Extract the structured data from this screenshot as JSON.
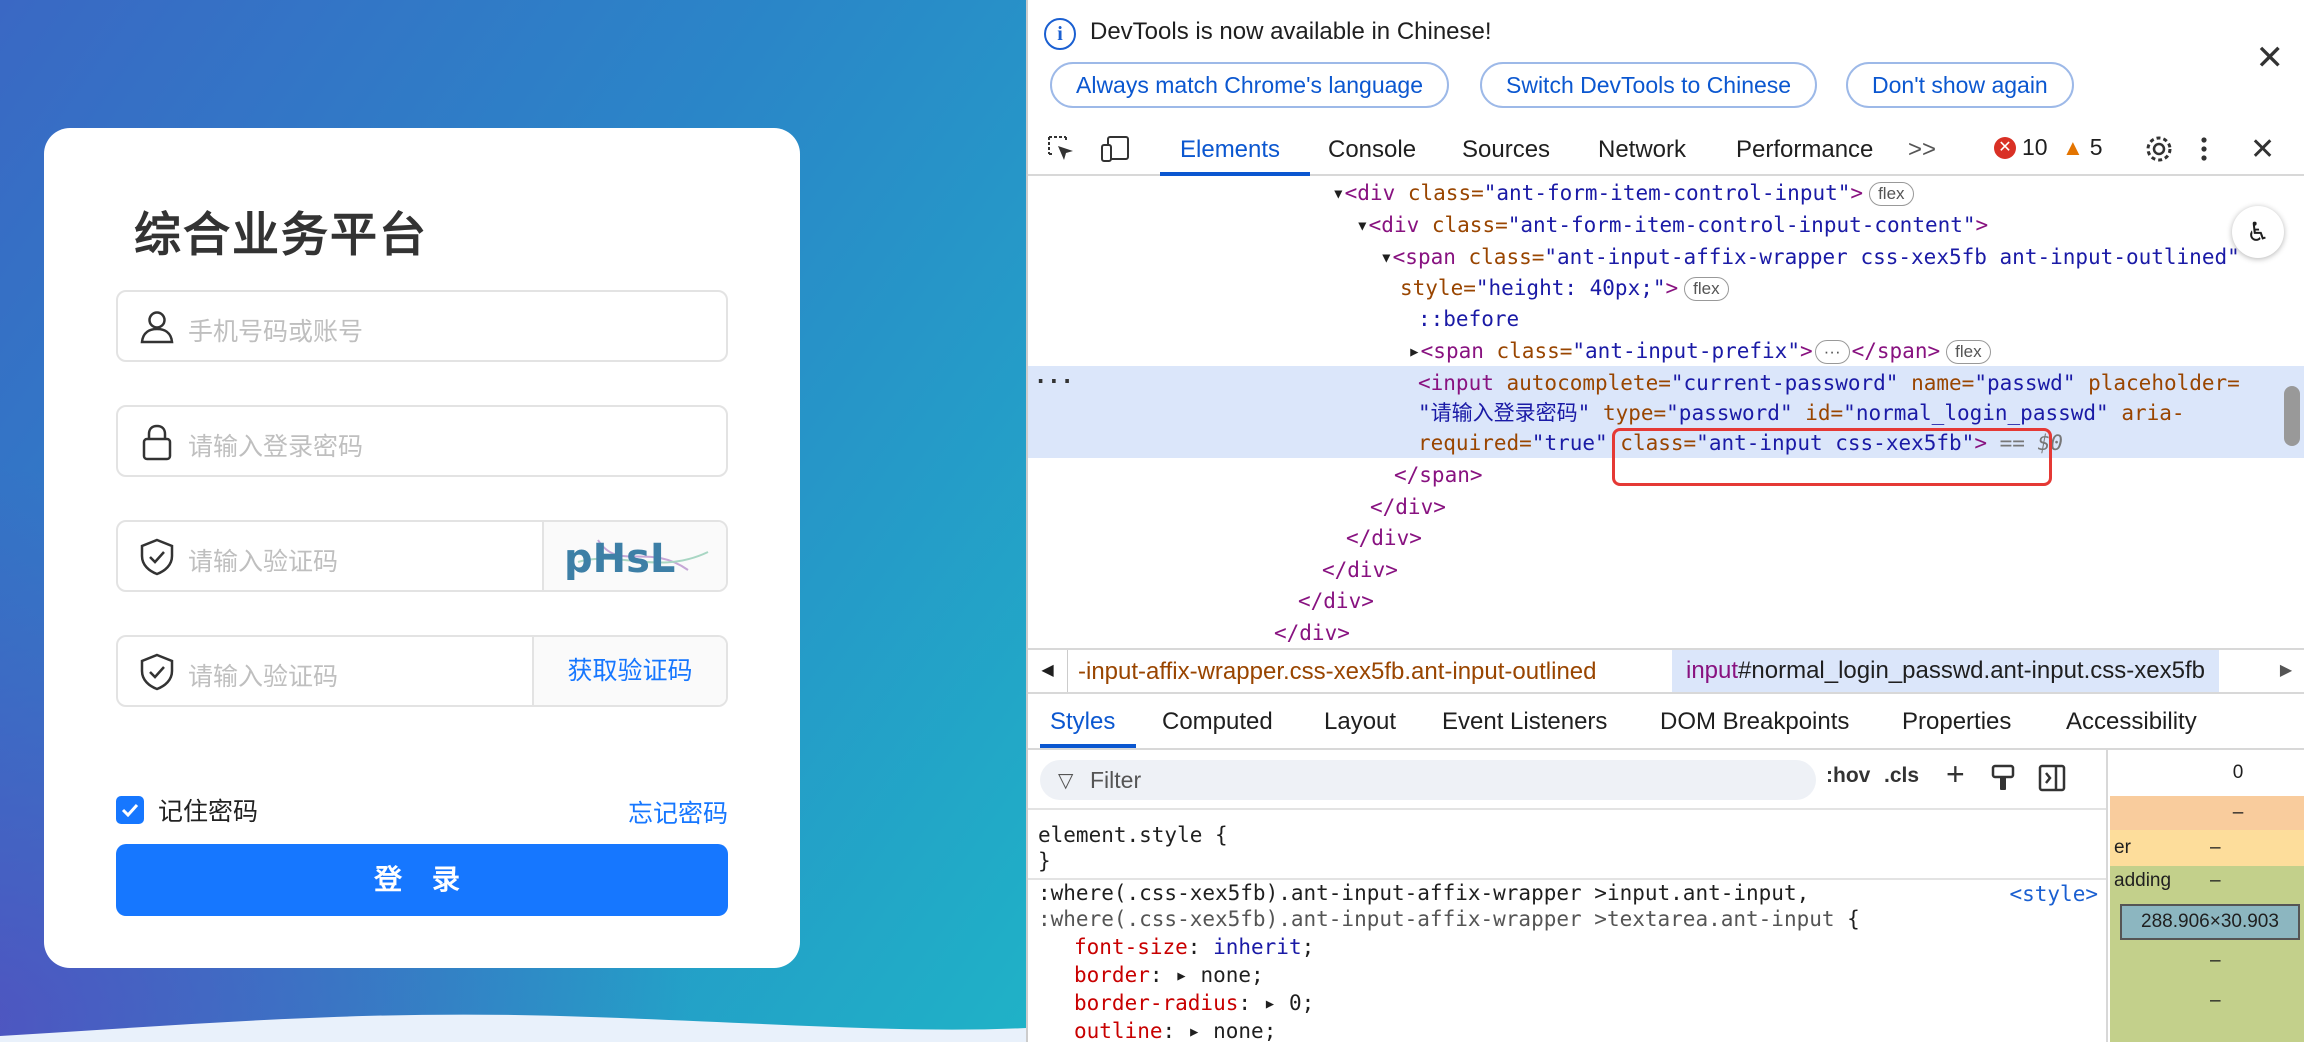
{
  "login": {
    "title": "综合业务平台",
    "phone_placeholder": "手机号码或账号",
    "password_placeholder": "请输入登录密码",
    "captcha_placeholder": "请输入验证码",
    "captcha_text": "pHsL",
    "sms_placeholder": "请输入验证码",
    "sms_button": "获取验证码",
    "remember_label": "记住密码",
    "remember_checked": true,
    "forgot_link": "忘记密码",
    "login_button": "登 录",
    "brand_color": "#1677ff"
  },
  "devtools": {
    "infobar": {
      "message": "DevTools is now available in Chinese!",
      "btn_match": "Always match Chrome's language",
      "btn_switch": "Switch DevTools to Chinese",
      "btn_dont": "Don't show again"
    },
    "tabs": [
      "Elements",
      "Console",
      "Sources",
      "Network",
      "Performance"
    ],
    "active_tab": "Elements",
    "more_tabs": ">>",
    "errors": "10",
    "warnings": "5",
    "dom_lines": {
      "l1_tag": "<div",
      "l1_attr": " class=",
      "l1_val": "\"ant-form-item-control-input\"",
      "l1_end": ">",
      "l2_tag": "<div",
      "l2_attr": " class=",
      "l2_val": "\"ant-form-item-control-input-content\"",
      "l2_end": ">",
      "l3_tag": "<span",
      "l3_attr": " class=",
      "l3_val": "\"ant-input-affix-wrapper css-xex5fb ant-input-outlined\"",
      "l4_attr": "style=",
      "l4_val": "\"height: 40px;\"",
      "l4_end": ">",
      "l5": "::before",
      "l6_tag": "<span",
      "l6_attr": " class=",
      "l6_val": "\"ant-input-prefix\"",
      "l6_end": ">",
      "l6_close": "</span>",
      "l7_tag": "<input",
      "l7_a1": " autocomplete=",
      "l7_v1": "\"current-password\"",
      "l7_a2": " name=",
      "l7_v2": "\"passwd\"",
      "l7_a3": " placeholder=",
      "l8_v3": "\"请输入登录密码\"",
      "l8_a4": " type=",
      "l8_v4": "\"password\"",
      "l8_a5": " id=",
      "l8_v5": "\"normal_login_passwd\"",
      "l8_a6": " aria-",
      "l9_a6": "required=",
      "l9_v6": "\"true\"",
      "l9_a7": " class=",
      "l9_v7": "\"ant-input css-xex5fb\"",
      "l9_end": ">",
      "l9_eq": " == ",
      "l9_ref": "$0",
      "close_span": "</span>",
      "close_div": "</div>",
      "flex_badge": "flex",
      "ellipsis": "..."
    },
    "breadcrumbs": {
      "crumb1": "-input-affix-wrapper.css-xex5fb.ant-input-outlined",
      "crumb2_tag": "input",
      "crumb2_rest": "#normal_login_passwd.ant-input.css-xex5fb"
    },
    "subtabs": [
      "Styles",
      "Computed",
      "Layout",
      "Event Listeners",
      "DOM Breakpoints",
      "Properties",
      "Accessibility"
    ],
    "active_subtab": "Styles",
    "filter_placeholder": "Filter",
    "hov": ":hov",
    "cls": ".cls",
    "styles": {
      "element_style": "element.style {",
      "close_brace": "}",
      "rule_selector_1": ":where(.css-xex5fb).ant-input-affix-wrapper >input.ant-input,",
      "rule_selector_2": ":where(.css-xex5fb).ant-input-affix-wrapper >textarea.ant-input",
      "open_brace": " {",
      "source": "<style>",
      "props": [
        {
          "name": "font-size",
          "value": "inherit",
          "arrow": false
        },
        {
          "name": "border",
          "value": "none",
          "arrow": true
        },
        {
          "name": "border-radius",
          "value": "0",
          "arrow": true
        },
        {
          "name": "outline",
          "value": "none",
          "arrow": true
        }
      ]
    },
    "box_model": {
      "margin_value": "0",
      "dash": "–",
      "border_label": "er",
      "padding_label": "adding",
      "content_size": "288.906×30.903"
    }
  }
}
